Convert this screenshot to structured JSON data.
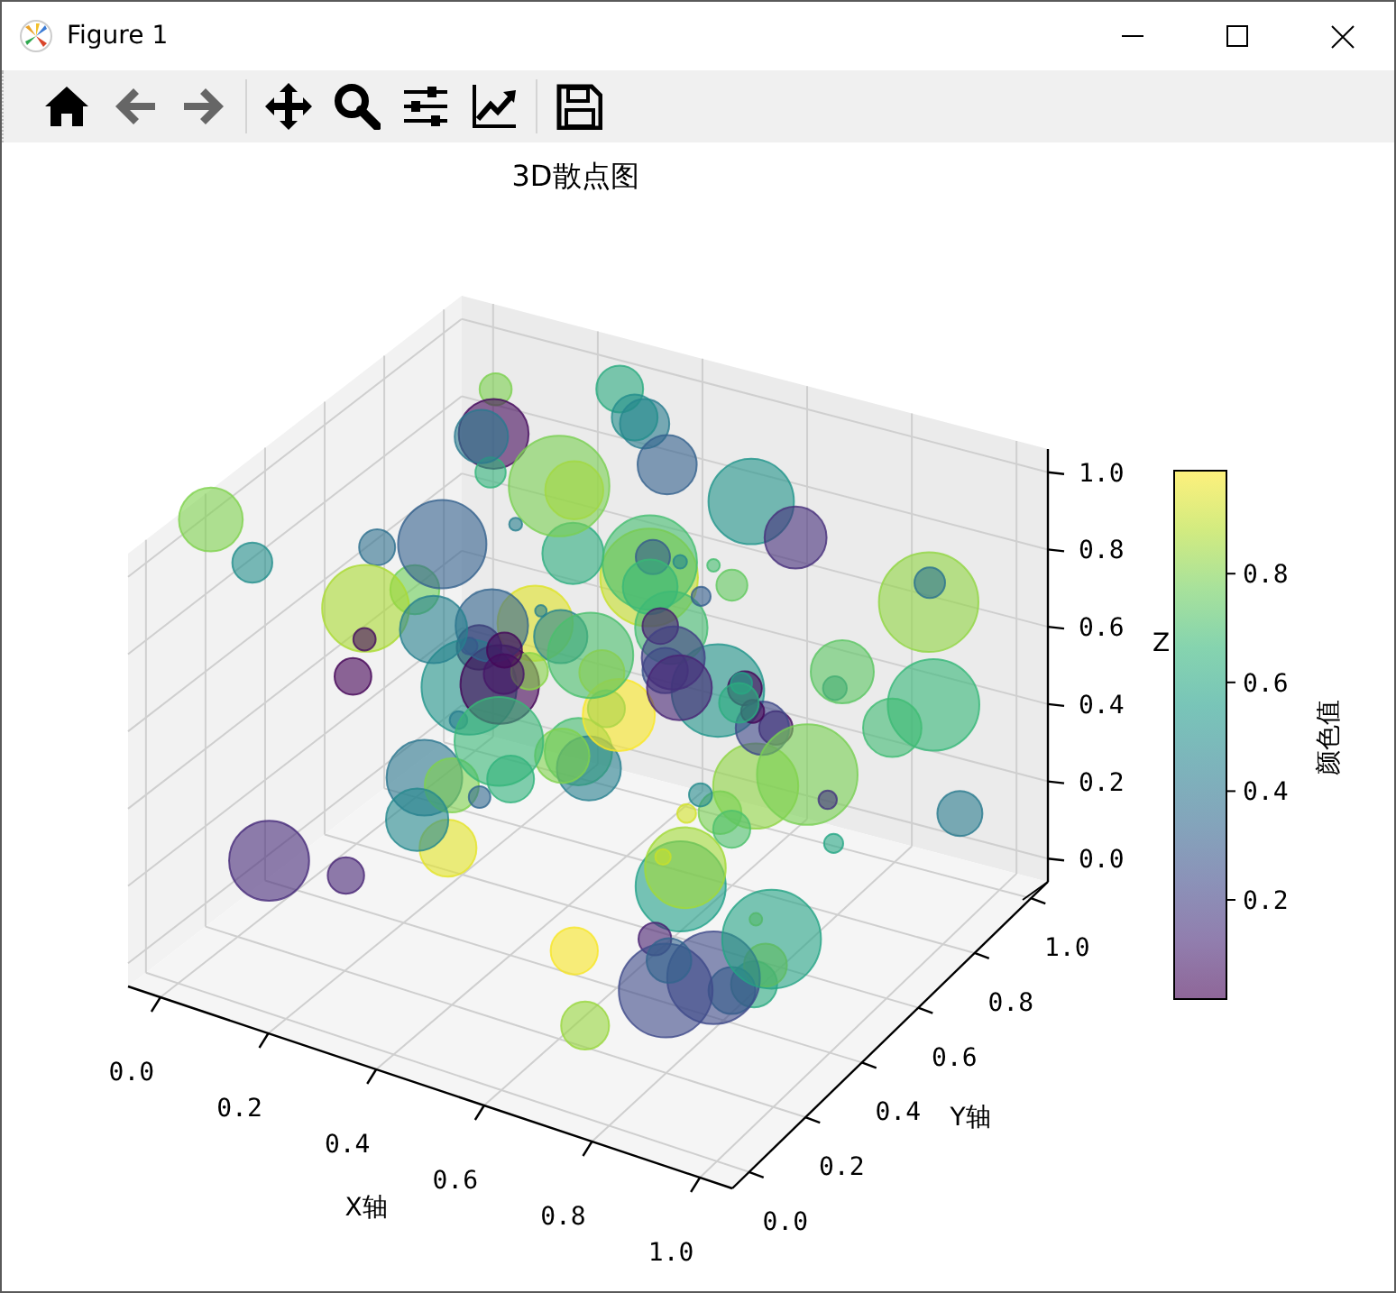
{
  "window": {
    "title": "Figure 1"
  },
  "toolbar": [
    {
      "kind": "home"
    },
    {
      "kind": "back"
    },
    {
      "kind": "forward"
    },
    {
      "kind": "separator"
    },
    {
      "kind": "pan"
    },
    {
      "kind": "zoom"
    },
    {
      "kind": "configure"
    },
    {
      "kind": "edit"
    },
    {
      "kind": "separator"
    },
    {
      "kind": "save"
    }
  ],
  "plot": {
    "title": "3D散点图",
    "xlabel": "X轴",
    "ylabel": "Y轴",
    "zlabel": "Z",
    "xticks": [
      "0.0",
      "0.2",
      "0.4",
      "0.6",
      "0.8",
      "1.0"
    ],
    "yticks": [
      "0.0",
      "0.2",
      "0.4",
      "0.6",
      "0.8",
      "1.0"
    ],
    "zticks": [
      "1.0",
      "0.8",
      "0.6",
      "0.4",
      "0.2",
      "0.0"
    ],
    "colorbar": {
      "label": "颜色值",
      "ticks": [
        "0.8",
        "0.6",
        "0.4",
        "0.2"
      ]
    }
  }
}
